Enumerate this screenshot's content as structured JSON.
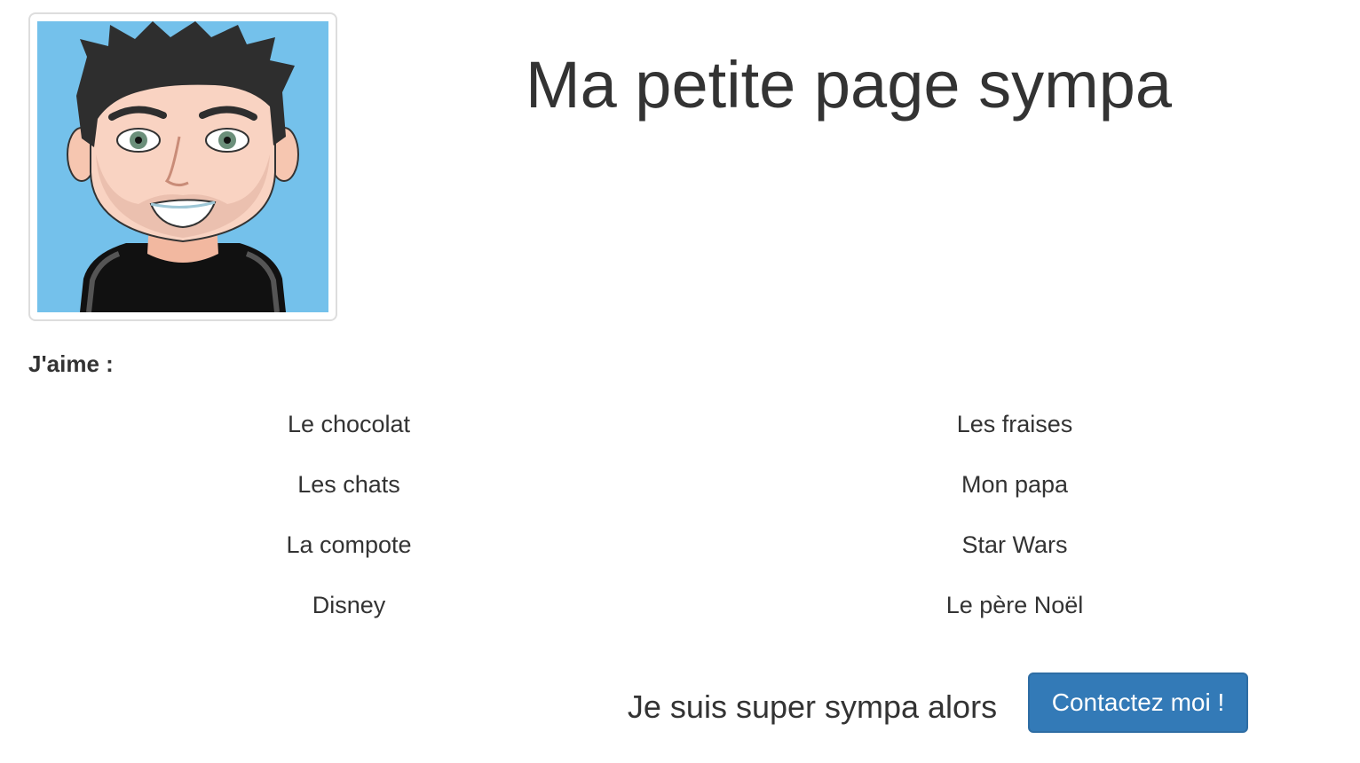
{
  "header": {
    "title": "Ma petite page sympa"
  },
  "avatar": {
    "icon": "avatar-illustration",
    "background_color": "#74c1eb"
  },
  "likes": {
    "heading": "J'aime :",
    "items": [
      "Le chocolat",
      "Les fraises",
      "Les chats",
      "Mon papa",
      "La compote",
      "Star Wars",
      "Disney",
      "Le père Noël"
    ]
  },
  "footer": {
    "tagline": "Je suis super sympa alors",
    "contact_label": "Contactez moi !"
  },
  "colors": {
    "button_primary": "#337ab7",
    "text": "#333333"
  }
}
